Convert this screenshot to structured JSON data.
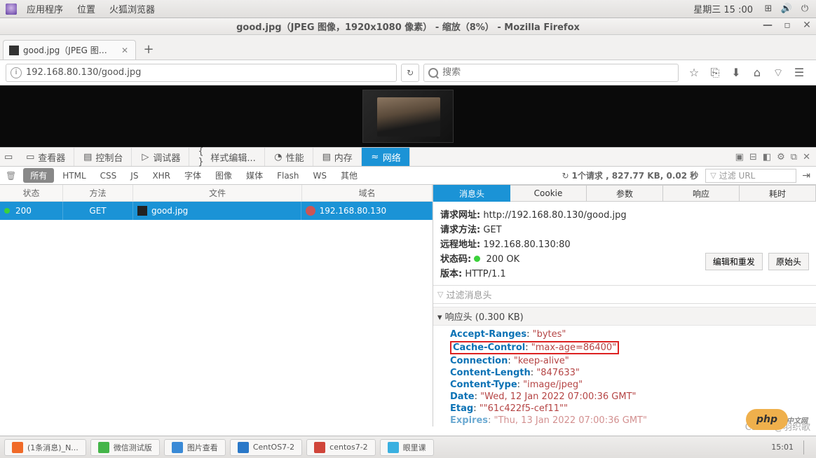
{
  "gnome": {
    "menu": {
      "apps": "应用程序",
      "places": "位置",
      "firefox": "火狐浏览器"
    },
    "date": "星期三 15 :00"
  },
  "window": {
    "title": "good.jpg（JPEG 图像，1920x1080 像素） - 缩放（8%） - Mozilla Firefox"
  },
  "tab": {
    "title": "good.jpg（JPEG 图像..."
  },
  "url": {
    "value": "192.168.80.130/good.jpg"
  },
  "search": {
    "placeholder": "搜索"
  },
  "devtools": {
    "inspector": "查看器",
    "console": "控制台",
    "debugger": "调试器",
    "style": "样式编辑...",
    "perf": "性能",
    "memory": "内存",
    "network": "网络"
  },
  "filters": {
    "all": "所有",
    "html": "HTML",
    "css": "CSS",
    "js": "JS",
    "xhr": "XHR",
    "fonts": "字体",
    "images": "图像",
    "media": "媒体",
    "flash": "Flash",
    "ws": "WS",
    "other": "其他"
  },
  "summary": "1个请求 , 827.77 KB, 0.02 秒",
  "urlfilter": "过滤 URL",
  "netcols": {
    "status": "状态",
    "method": "方法",
    "file": "文件",
    "domain": "域名"
  },
  "row": {
    "status": "200",
    "method": "GET",
    "file": "good.jpg",
    "domain": "192.168.80.130"
  },
  "dtabs": {
    "headers": "消息头",
    "cookies": "Cookie",
    "params": "参数",
    "response": "响应",
    "timings": "耗时"
  },
  "detail": {
    "url_l": "请求网址:",
    "url_v": "http://192.168.80.130/good.jpg",
    "method_l": "请求方法:",
    "method_v": "GET",
    "remote_l": "远程地址:",
    "remote_v": "192.168.80.130:80",
    "status_l": "状态码:",
    "status_v": "200  OK",
    "version_l": "版本:",
    "version_v": "HTTP/1.1",
    "btn_edit": "编辑和重发",
    "btn_raw": "原始头",
    "filter_placeholder": "过滤消息头",
    "resp_hdr": "响应头 (0.300 KB)"
  },
  "headers": {
    "accept_ranges": {
      "n": "Accept-Ranges",
      "v": "\"bytes\""
    },
    "cache_control": {
      "n": "Cache-Control",
      "v": "\"max-age=86400\""
    },
    "connection": {
      "n": "Connection",
      "v": "\"keep-alive\""
    },
    "content_length": {
      "n": "Content-Length",
      "v": "\"847633\""
    },
    "content_type": {
      "n": "Content-Type",
      "v": "\"image/jpeg\""
    },
    "date": {
      "n": "Date",
      "v": "\"Wed, 12 Jan 2022 07:00:36 GMT\""
    },
    "etag": {
      "n": "Etag",
      "v": "\"\"61c422f5-cef11\"\""
    },
    "expires": {
      "n": "Expires",
      "v": "\"Thu, 13 Jan 2022 07:00:36 GMT\""
    }
  },
  "taskbar": {
    "t1": "(1条消息)_N...",
    "t2": "微信测试版",
    "t3": "图片查看",
    "t4": "CentOS7-2",
    "t5": "centos7-2",
    "t6": "眼里课"
  },
  "clock": "15:01",
  "watermark": "CSDN @羽织歌",
  "php": "php",
  "phpcn": "中文网"
}
